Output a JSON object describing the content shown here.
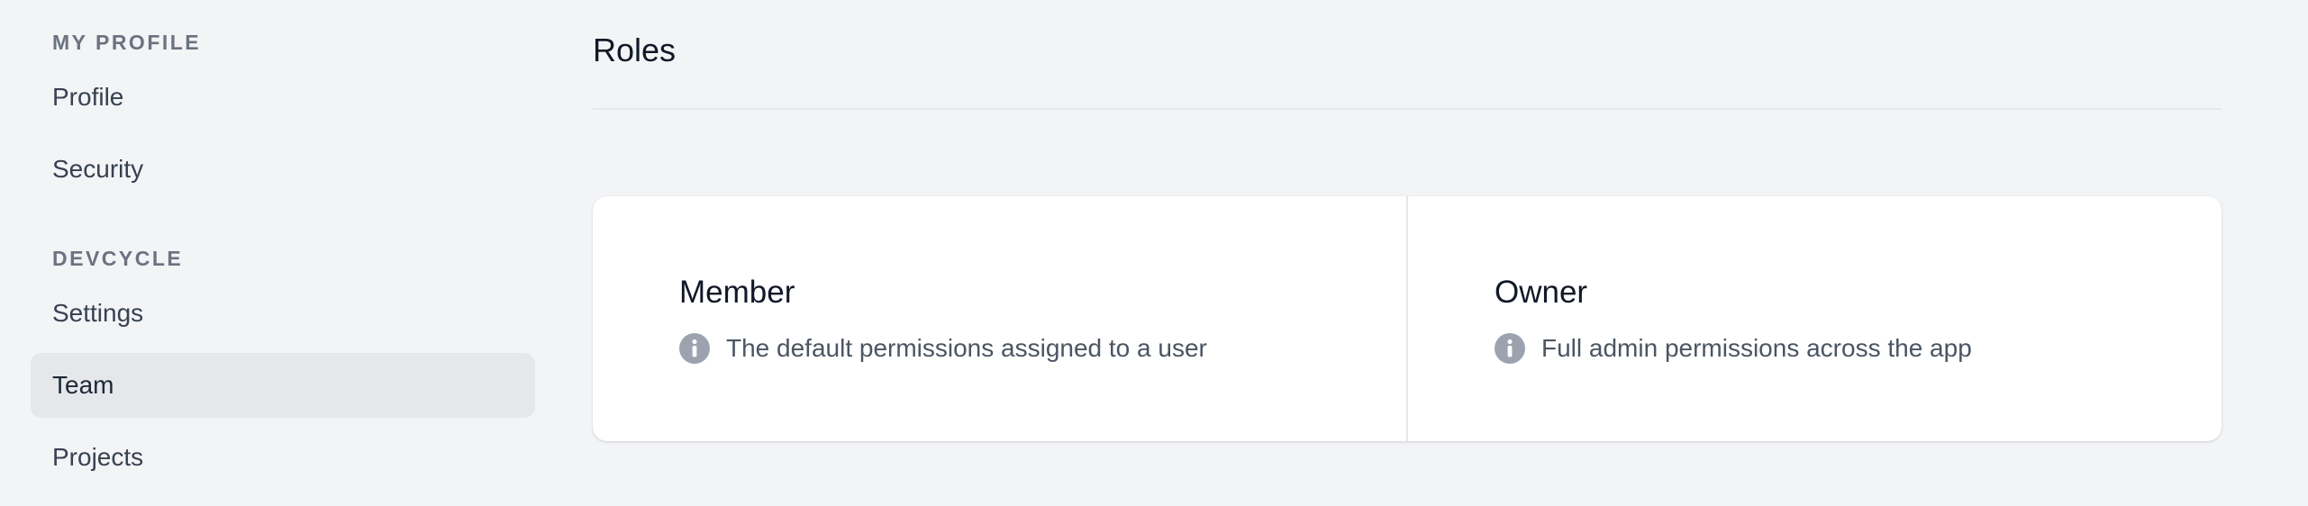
{
  "sidebar": {
    "sections": [
      {
        "label": "MY PROFILE",
        "items": [
          {
            "label": "Profile"
          },
          {
            "label": "Security"
          }
        ]
      },
      {
        "label": "DEVCYCLE",
        "items": [
          {
            "label": "Settings"
          },
          {
            "label": "Team",
            "active": true
          },
          {
            "label": "Projects"
          }
        ]
      }
    ]
  },
  "main": {
    "title": "Roles",
    "roles": [
      {
        "name": "Member",
        "description": "The default permissions assigned to a user",
        "icon": "info-icon"
      },
      {
        "name": "Owner",
        "description": "Full admin permissions across the app",
        "icon": "info-icon"
      }
    ]
  },
  "colors": {
    "background": "#f3f4f6",
    "active_nav": "#e5e7eb",
    "card": "#ffffff",
    "icon": "#9ca3af"
  }
}
